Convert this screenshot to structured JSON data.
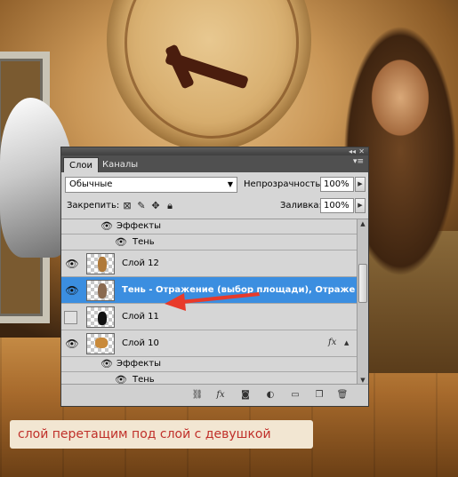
{
  "panel": {
    "tabs": [
      {
        "label": "Слои",
        "active": true
      },
      {
        "label": "Каналы",
        "active": false
      }
    ],
    "blend_mode": "Обычные",
    "opacity_label": "Непрозрачность:",
    "opacity_value": "100%",
    "lock_label": "Закрепить:",
    "fill_label": "Заливка:",
    "fill_value": "100%"
  },
  "layers": {
    "effects_top": {
      "effects_label": "Эффекты",
      "effect_name": "Тень"
    },
    "items": [
      {
        "name": "Слой 12",
        "visible": true,
        "selected": false
      },
      {
        "name": "Тень - Отражение (выбор площади), Отраже...",
        "visible": true,
        "selected": true
      },
      {
        "name": "Слой 11",
        "visible": false,
        "selected": false
      },
      {
        "name": "Слой 10",
        "visible": true,
        "selected": false,
        "fx": "fx"
      }
    ],
    "effects_bottom": {
      "effects_label": "Эффекты",
      "effect_name": "Тень"
    }
  },
  "caption": "слой перетащим под слой с девушкой",
  "colors": {
    "selection": "#3b8ee0",
    "annotation_arrow": "#e83a2a",
    "caption_text": "#c0302a",
    "caption_bg": "#f2e6d2"
  },
  "icons": {
    "lock": [
      "transparency-lock-icon",
      "brush-lock-icon",
      "move-lock-icon",
      "padlock-icon"
    ],
    "bottom": [
      "link-icon",
      "fx-icon",
      "mask-icon",
      "adjustment-icon",
      "group-folder-icon",
      "new-layer-icon",
      "trash-icon"
    ]
  }
}
